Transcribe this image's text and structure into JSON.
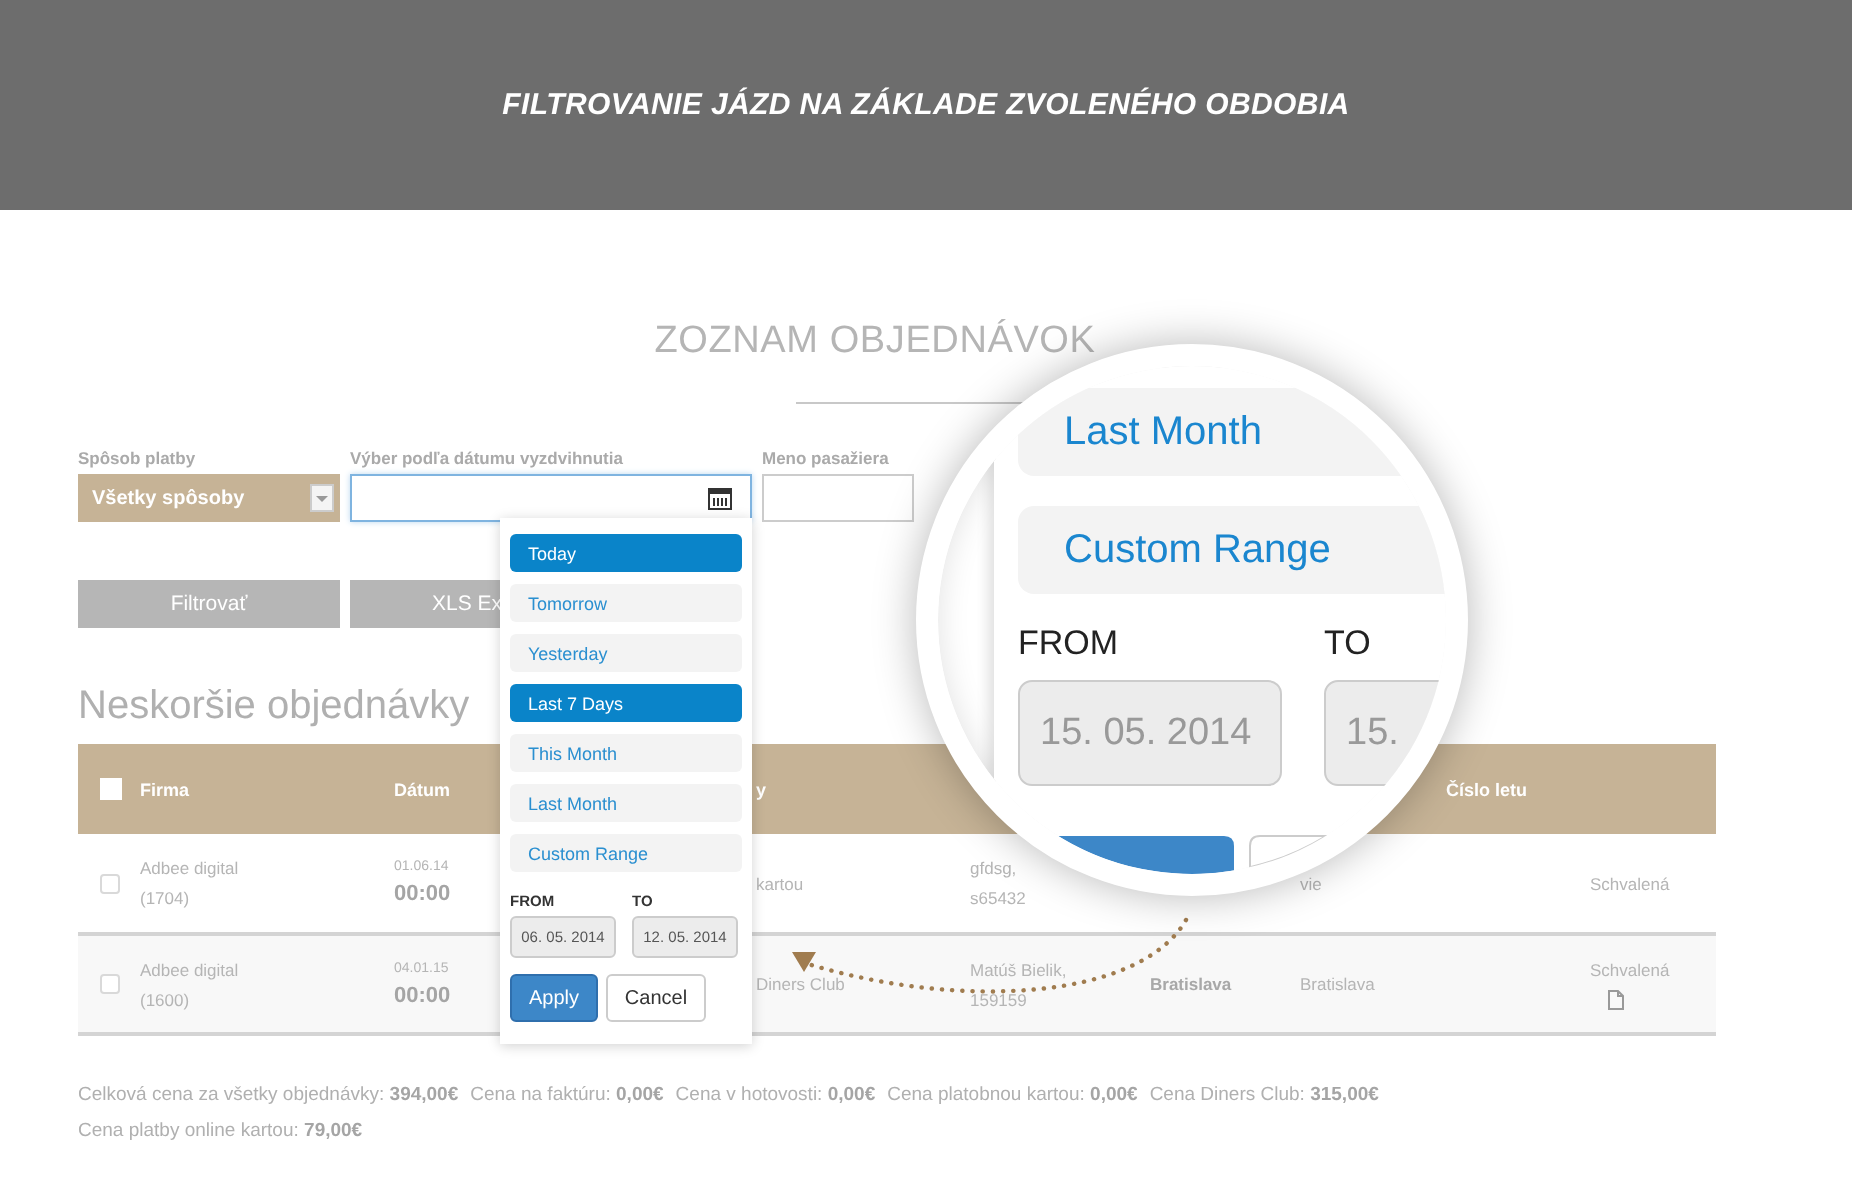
{
  "banner": {
    "title": "FILTROVANIE JÁZD NA ZÁKLADE ZVOLENÉHO OBDOBIA"
  },
  "page_title": "ZOZNAM OBJEDNÁVOK",
  "filters": {
    "payment_label": "Spôsob platby",
    "payment_value": "Všetky spôsoby",
    "date_label": "Výber podľa dátumu vyzdvihnutia",
    "passenger_label": "Meno pasažiera"
  },
  "buttons": [
    "Filtrovať",
    "XLS Ex"
  ],
  "date_dropdown": {
    "ranges": [
      {
        "label": "Today",
        "selected": true
      },
      {
        "label": "Tomorrow",
        "selected": false
      },
      {
        "label": "Yesterday",
        "selected": false
      },
      {
        "label": "Last 7 Days",
        "selected": true
      },
      {
        "label": "This Month",
        "selected": false
      },
      {
        "label": "Last Month",
        "selected": false
      },
      {
        "label": "Custom Range",
        "selected": false
      }
    ],
    "from_label": "FROM",
    "to_label": "TO",
    "from_value": "06. 05. 2014",
    "to_value": "12. 05. 2014",
    "apply": "Apply",
    "cancel": "Cancel"
  },
  "section_title": "Neskoršie objednávky",
  "table": {
    "header_checked": false,
    "columns": [
      {
        "label": "Firma"
      },
      {
        "label": "Dátum"
      },
      {
        "label": "y"
      },
      {},
      {},
      {},
      {
        "label": "Číslo letu"
      },
      {}
    ],
    "rows": [
      {
        "checked": false,
        "cells": [
          {
            "kind": "text",
            "lines": [
              "Adbee digital",
              "(1704)"
            ]
          },
          {
            "kind": "datetime",
            "lines": [
              "01.06.14",
              "00:00"
            ]
          },
          {
            "kind": "text",
            "lines": [
              "kartou"
            ]
          },
          {
            "kind": "text",
            "lines": [
              "gfdsg,",
              "s65432"
            ]
          },
          {},
          {
            "kind": "text",
            "lines": [
              "vie"
            ]
          },
          {},
          {
            "kind": "text",
            "lines": [
              "Schvalená"
            ],
            "document": false
          }
        ]
      },
      {
        "checked": false,
        "cells": [
          {
            "kind": "text",
            "lines": [
              "Adbee digital",
              "(1600)"
            ]
          },
          {
            "kind": "datetime",
            "lines": [
              "04.01.15",
              "00:00"
            ]
          },
          {
            "kind": "text",
            "lines": [
              "Diners Club"
            ]
          },
          {
            "kind": "text",
            "lines": [
              "Matúš Bielik,",
              "159159"
            ]
          },
          {
            "kind": "text",
            "lines": [
              "Bratislava"
            ],
            "bold": true
          },
          {
            "kind": "text",
            "lines": [
              "Bratislava"
            ]
          },
          {},
          {
            "kind": "text",
            "lines": [
              "Schvalená"
            ],
            "document": true
          }
        ]
      }
    ]
  },
  "totals": [
    {
      "label": "Celková cena za všetky objednávky:",
      "value": "394,00€"
    },
    {
      "label": "Cena na faktúru:",
      "value": "0,00€"
    },
    {
      "label": "Cena v hotovosti:",
      "value": "0,00€"
    },
    {
      "label": "Cena platobnou kartou:",
      "value": "0,00€"
    },
    {
      "label": "Cena Diners Club:",
      "value": "315,00€"
    },
    {
      "label": "Cena platby online kartou:",
      "value": "79,00€"
    }
  ],
  "magnifier": {
    "ranges": [
      {
        "label": "Last Month",
        "selected": false
      },
      {
        "label": "Custom Range",
        "selected": false
      }
    ],
    "from_label": "FROM",
    "to_label": "TO",
    "from_value": "15. 05. 2014",
    "to_value": "15."
  }
}
